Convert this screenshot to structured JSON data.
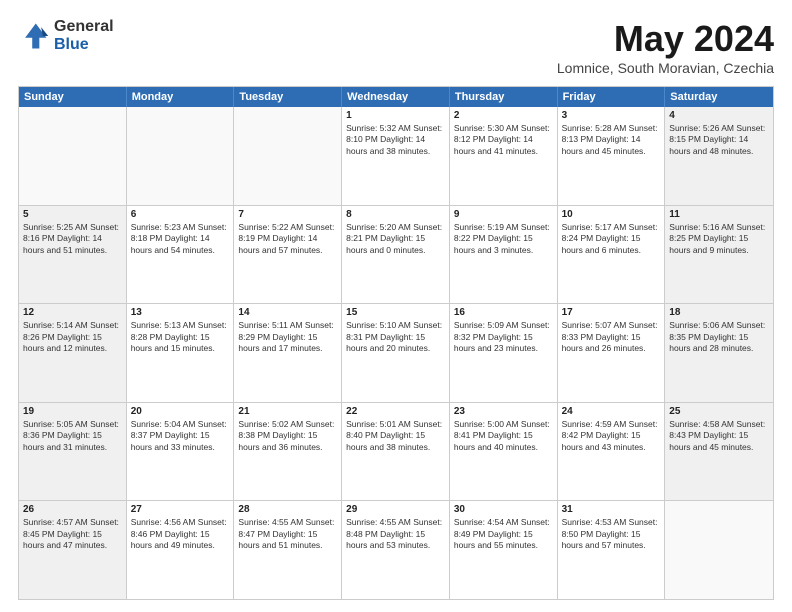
{
  "header": {
    "logo_general": "General",
    "logo_blue": "Blue",
    "title": "May 2024",
    "subtitle": "Lomnice, South Moravian, Czechia"
  },
  "calendar": {
    "days_of_week": [
      "Sunday",
      "Monday",
      "Tuesday",
      "Wednesday",
      "Thursday",
      "Friday",
      "Saturday"
    ],
    "weeks": [
      [
        {
          "day": "",
          "info": "",
          "empty": true
        },
        {
          "day": "",
          "info": "",
          "empty": true
        },
        {
          "day": "",
          "info": "",
          "empty": true
        },
        {
          "day": "1",
          "info": "Sunrise: 5:32 AM\nSunset: 8:10 PM\nDaylight: 14 hours\nand 38 minutes."
        },
        {
          "day": "2",
          "info": "Sunrise: 5:30 AM\nSunset: 8:12 PM\nDaylight: 14 hours\nand 41 minutes."
        },
        {
          "day": "3",
          "info": "Sunrise: 5:28 AM\nSunset: 8:13 PM\nDaylight: 14 hours\nand 45 minutes."
        },
        {
          "day": "4",
          "info": "Sunrise: 5:26 AM\nSunset: 8:15 PM\nDaylight: 14 hours\nand 48 minutes.",
          "shaded": true
        }
      ],
      [
        {
          "day": "5",
          "info": "Sunrise: 5:25 AM\nSunset: 8:16 PM\nDaylight: 14 hours\nand 51 minutes.",
          "shaded": true
        },
        {
          "day": "6",
          "info": "Sunrise: 5:23 AM\nSunset: 8:18 PM\nDaylight: 14 hours\nand 54 minutes."
        },
        {
          "day": "7",
          "info": "Sunrise: 5:22 AM\nSunset: 8:19 PM\nDaylight: 14 hours\nand 57 minutes."
        },
        {
          "day": "8",
          "info": "Sunrise: 5:20 AM\nSunset: 8:21 PM\nDaylight: 15 hours\nand 0 minutes."
        },
        {
          "day": "9",
          "info": "Sunrise: 5:19 AM\nSunset: 8:22 PM\nDaylight: 15 hours\nand 3 minutes."
        },
        {
          "day": "10",
          "info": "Sunrise: 5:17 AM\nSunset: 8:24 PM\nDaylight: 15 hours\nand 6 minutes."
        },
        {
          "day": "11",
          "info": "Sunrise: 5:16 AM\nSunset: 8:25 PM\nDaylight: 15 hours\nand 9 minutes.",
          "shaded": true
        }
      ],
      [
        {
          "day": "12",
          "info": "Sunrise: 5:14 AM\nSunset: 8:26 PM\nDaylight: 15 hours\nand 12 minutes.",
          "shaded": true
        },
        {
          "day": "13",
          "info": "Sunrise: 5:13 AM\nSunset: 8:28 PM\nDaylight: 15 hours\nand 15 minutes."
        },
        {
          "day": "14",
          "info": "Sunrise: 5:11 AM\nSunset: 8:29 PM\nDaylight: 15 hours\nand 17 minutes."
        },
        {
          "day": "15",
          "info": "Sunrise: 5:10 AM\nSunset: 8:31 PM\nDaylight: 15 hours\nand 20 minutes."
        },
        {
          "day": "16",
          "info": "Sunrise: 5:09 AM\nSunset: 8:32 PM\nDaylight: 15 hours\nand 23 minutes."
        },
        {
          "day": "17",
          "info": "Sunrise: 5:07 AM\nSunset: 8:33 PM\nDaylight: 15 hours\nand 26 minutes."
        },
        {
          "day": "18",
          "info": "Sunrise: 5:06 AM\nSunset: 8:35 PM\nDaylight: 15 hours\nand 28 minutes.",
          "shaded": true
        }
      ],
      [
        {
          "day": "19",
          "info": "Sunrise: 5:05 AM\nSunset: 8:36 PM\nDaylight: 15 hours\nand 31 minutes.",
          "shaded": true
        },
        {
          "day": "20",
          "info": "Sunrise: 5:04 AM\nSunset: 8:37 PM\nDaylight: 15 hours\nand 33 minutes."
        },
        {
          "day": "21",
          "info": "Sunrise: 5:02 AM\nSunset: 8:38 PM\nDaylight: 15 hours\nand 36 minutes."
        },
        {
          "day": "22",
          "info": "Sunrise: 5:01 AM\nSunset: 8:40 PM\nDaylight: 15 hours\nand 38 minutes."
        },
        {
          "day": "23",
          "info": "Sunrise: 5:00 AM\nSunset: 8:41 PM\nDaylight: 15 hours\nand 40 minutes."
        },
        {
          "day": "24",
          "info": "Sunrise: 4:59 AM\nSunset: 8:42 PM\nDaylight: 15 hours\nand 43 minutes."
        },
        {
          "day": "25",
          "info": "Sunrise: 4:58 AM\nSunset: 8:43 PM\nDaylight: 15 hours\nand 45 minutes.",
          "shaded": true
        }
      ],
      [
        {
          "day": "26",
          "info": "Sunrise: 4:57 AM\nSunset: 8:45 PM\nDaylight: 15 hours\nand 47 minutes.",
          "shaded": true
        },
        {
          "day": "27",
          "info": "Sunrise: 4:56 AM\nSunset: 8:46 PM\nDaylight: 15 hours\nand 49 minutes."
        },
        {
          "day": "28",
          "info": "Sunrise: 4:55 AM\nSunset: 8:47 PM\nDaylight: 15 hours\nand 51 minutes."
        },
        {
          "day": "29",
          "info": "Sunrise: 4:55 AM\nSunset: 8:48 PM\nDaylight: 15 hours\nand 53 minutes."
        },
        {
          "day": "30",
          "info": "Sunrise: 4:54 AM\nSunset: 8:49 PM\nDaylight: 15 hours\nand 55 minutes."
        },
        {
          "day": "31",
          "info": "Sunrise: 4:53 AM\nSunset: 8:50 PM\nDaylight: 15 hours\nand 57 minutes."
        },
        {
          "day": "",
          "info": "",
          "empty": true,
          "shaded": true
        }
      ]
    ]
  }
}
